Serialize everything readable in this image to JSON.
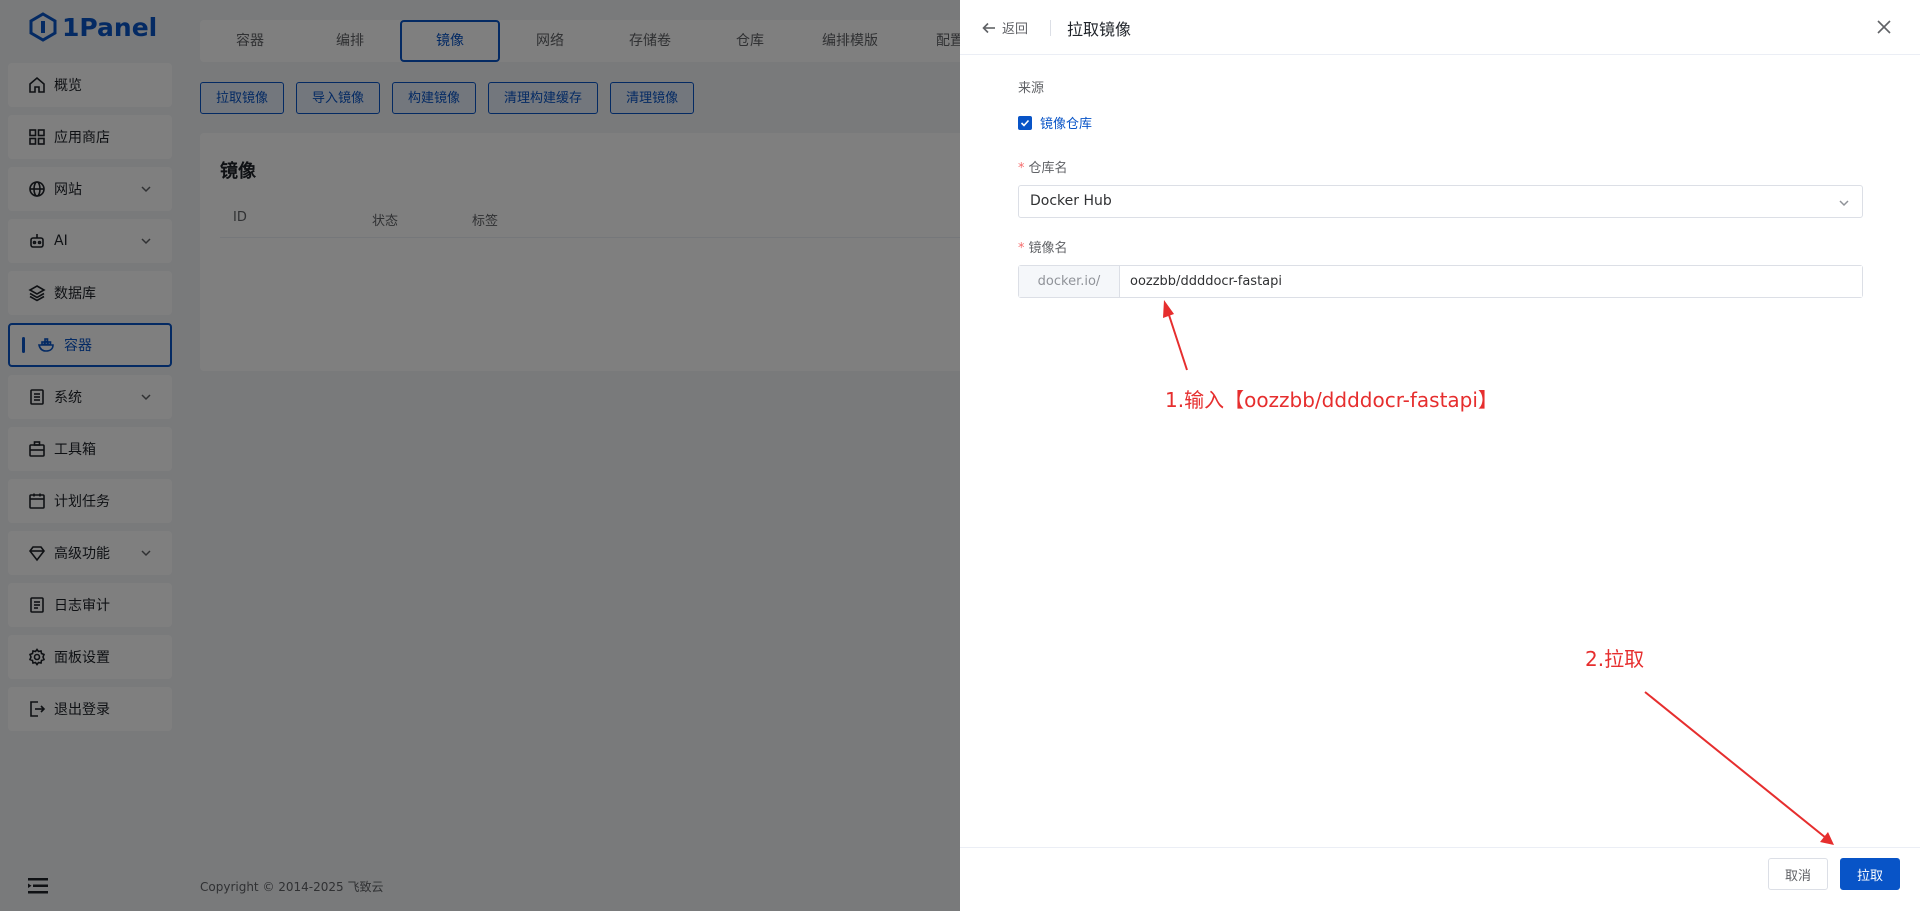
{
  "app": {
    "logo_text": "1Panel"
  },
  "sidebar": {
    "items": [
      {
        "label": "概览",
        "icon": "home-icon",
        "chevron": false
      },
      {
        "label": "应用商店",
        "icon": "grid-icon",
        "chevron": false
      },
      {
        "label": "网站",
        "icon": "globe-icon",
        "chevron": true
      },
      {
        "label": "AI",
        "icon": "robot-icon",
        "chevron": true
      },
      {
        "label": "数据库",
        "icon": "database-layers-icon",
        "chevron": false
      },
      {
        "label": "容器",
        "icon": "docker-icon",
        "chevron": false,
        "active": true
      },
      {
        "label": "系统",
        "icon": "server-icon",
        "chevron": true
      },
      {
        "label": "工具箱",
        "icon": "toolbox-icon",
        "chevron": false
      },
      {
        "label": "计划任务",
        "icon": "calendar-icon",
        "chevron": false
      },
      {
        "label": "高级功能",
        "icon": "diamond-icon",
        "chevron": true
      },
      {
        "label": "日志审计",
        "icon": "log-icon",
        "chevron": false
      },
      {
        "label": "面板设置",
        "icon": "gear-icon",
        "chevron": false
      },
      {
        "label": "退出登录",
        "icon": "logout-icon",
        "chevron": false
      }
    ]
  },
  "main": {
    "tabs": [
      {
        "label": "容器"
      },
      {
        "label": "编排"
      },
      {
        "label": "镜像",
        "active": true
      },
      {
        "label": "网络"
      },
      {
        "label": "存储卷"
      },
      {
        "label": "仓库"
      },
      {
        "label": "编排模版"
      },
      {
        "label": "配置"
      }
    ],
    "buttons": [
      "拉取镜像",
      "导入镜像",
      "构建镜像",
      "清理构建缓存",
      "清理镜像"
    ],
    "card": {
      "title": "镜像",
      "columns": [
        "ID",
        "状态",
        "标签"
      ]
    },
    "footer": "Copyright © 2014-2025 飞致云"
  },
  "drawer": {
    "back_label": "返回",
    "title": "拉取镜像",
    "source_label": "来源",
    "source_checkbox": "镜像仓库",
    "repo_label": "仓库名",
    "repo_value": "Docker Hub",
    "image_label": "镜像名",
    "image_prefix": "docker.io/",
    "image_value": "oozzbb/ddddocr-fastapi",
    "cancel_label": "取消",
    "confirm_label": "拉取"
  },
  "annotations": {
    "step1": "1.输入【oozzbb/ddddocr-fastapi】",
    "step2": "2.拉取",
    "color": "#e62e2e"
  },
  "colors": {
    "primary": "#0854c7",
    "danger": "#f56c6c"
  }
}
